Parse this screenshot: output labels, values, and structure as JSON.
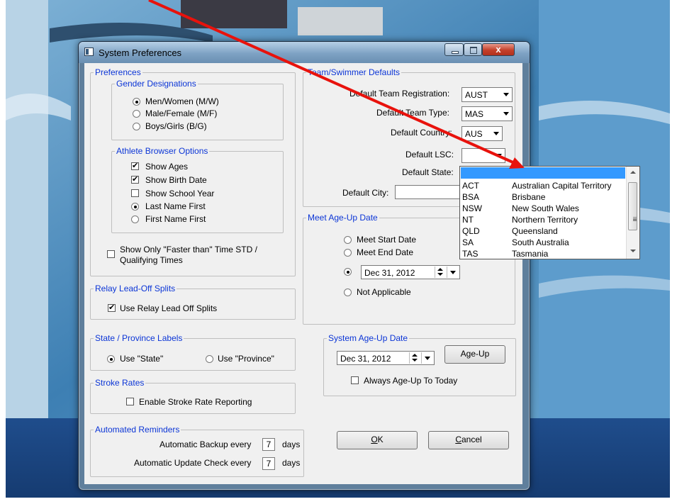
{
  "window": {
    "title": "System Preferences",
    "close_glyph": "x"
  },
  "preferences": {
    "legend": "Preferences",
    "gender": {
      "legend": "Gender Designations",
      "options": [
        "Men/Women (M/W)",
        "Male/Female (M/F)",
        "Boys/Girls (B/G)"
      ],
      "selected": 0
    },
    "athlete": {
      "legend": "Athlete Browser Options",
      "show_ages": "Show Ages",
      "show_birth_date": "Show Birth Date",
      "show_school_year": "Show School Year",
      "last_name_first": "Last Name First",
      "first_name_first": "First Name First",
      "checked": {
        "show_ages": true,
        "show_birth_date": true,
        "show_school_year": false
      },
      "name_order_selected": "last_name_first"
    },
    "faster_than_line1": "Show Only  \"Faster than\" Time STD /",
    "faster_than_line2": "Qualifying Times",
    "faster_than_checked": false
  },
  "relay": {
    "legend": "Relay Lead-Off Splits",
    "label": "Use Relay Lead Off Splits",
    "checked": true
  },
  "state_labels": {
    "legend": "State / Province Labels",
    "use_state": "Use \"State\"",
    "use_province": "Use \"Province\"",
    "selected": "state"
  },
  "stroke": {
    "legend": "Stroke Rates",
    "label": "Enable Stroke Rate Reporting",
    "checked": false
  },
  "reminders": {
    "legend": "Automated Reminders",
    "backup_label": "Automatic Backup every",
    "backup_value": "7",
    "update_label": "Automatic Update Check every",
    "update_value": "7",
    "days": "days"
  },
  "team_defaults": {
    "legend": "Team/Swimmer Defaults",
    "team_registration_label": "Default Team Registration:",
    "team_registration_value": "AUST",
    "team_type_label": "Default Team Type:",
    "team_type_value": "MAS",
    "country_label": "Default Country:",
    "country_value": "AUS",
    "lsc_label": "Default LSC:",
    "lsc_value": "",
    "state_label": "Default State:",
    "city_label": "Default City:",
    "city_value": ""
  },
  "state_dropdown": {
    "items": [
      {
        "code": "",
        "name": ""
      },
      {
        "code": "ACT",
        "name": "Australian Capital Territory"
      },
      {
        "code": "BSA",
        "name": "Brisbane"
      },
      {
        "code": "NSW",
        "name": "New South Wales"
      },
      {
        "code": "NT",
        "name": "Northern Territory"
      },
      {
        "code": "QLD",
        "name": "Queensland"
      },
      {
        "code": "SA",
        "name": "South Australia"
      },
      {
        "code": "TAS",
        "name": "Tasmania"
      }
    ],
    "selected_index": 0
  },
  "meet_age_up": {
    "legend": "Meet Age-Up Date",
    "start": "Meet Start Date",
    "end": "Meet End Date",
    "date_value": "Dec 31, 2012",
    "not_applicable": "Not Applicable",
    "selected": "date"
  },
  "system_age_up": {
    "legend": "System Age-Up Date",
    "date_value": "Dec 31, 2012",
    "button": "Age-Up",
    "always_label": "Always Age-Up To Today",
    "always_checked": false
  },
  "buttons": {
    "ok_mnemonic": "O",
    "ok_rest": "K",
    "cancel_mnemonic": "C",
    "cancel_rest": "ancel"
  },
  "colors": {
    "annotation_arrow": "#e8120c",
    "group_legend": "#0b35d6",
    "selection": "#3399ff"
  }
}
